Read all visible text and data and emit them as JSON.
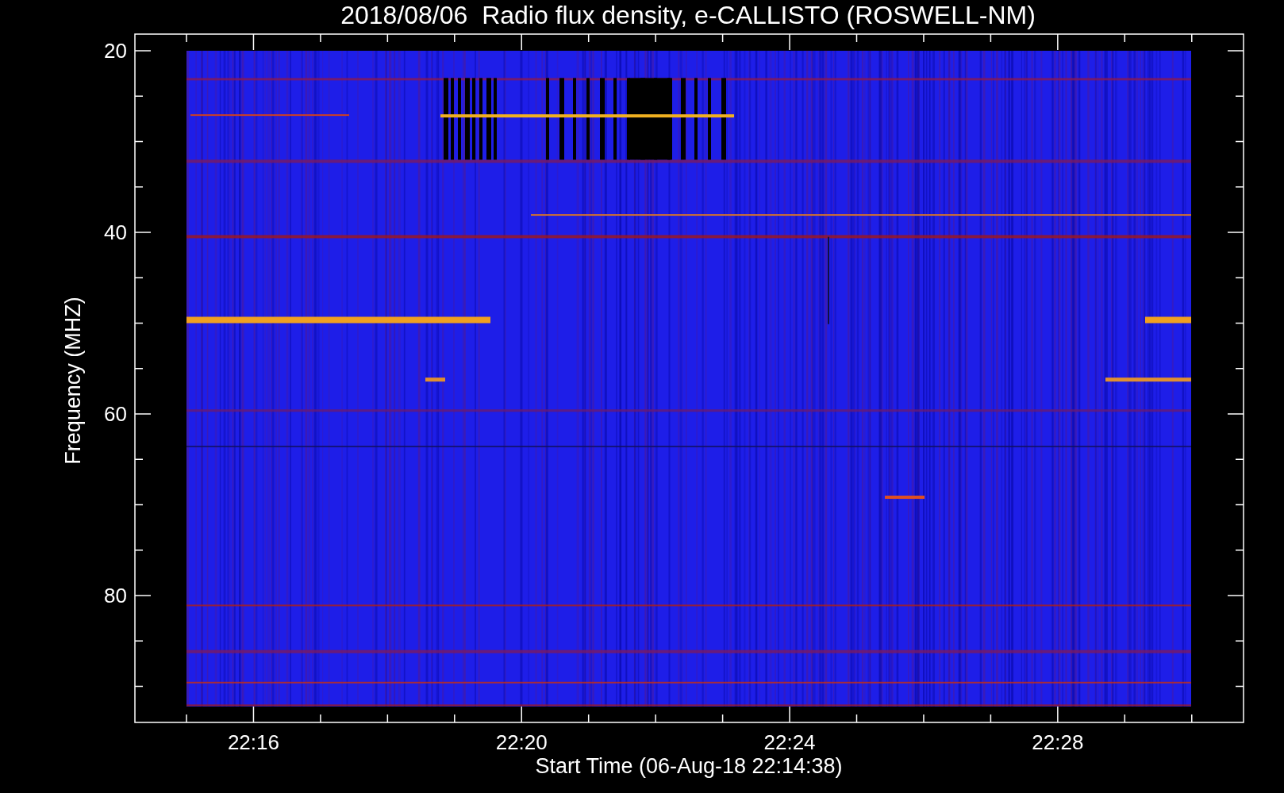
{
  "title": "2018/08/06  Radio flux density, e-CALLISTO (ROSWELL-NM)",
  "y_axis": {
    "label": "Frequency (MHZ)",
    "ticks": [
      "20",
      "40",
      "60",
      "80"
    ]
  },
  "x_axis": {
    "label": "Start Time (06-Aug-18 22:14:38)",
    "ticks": [
      "22:16",
      "22:20",
      "22:24",
      "22:28"
    ]
  }
}
